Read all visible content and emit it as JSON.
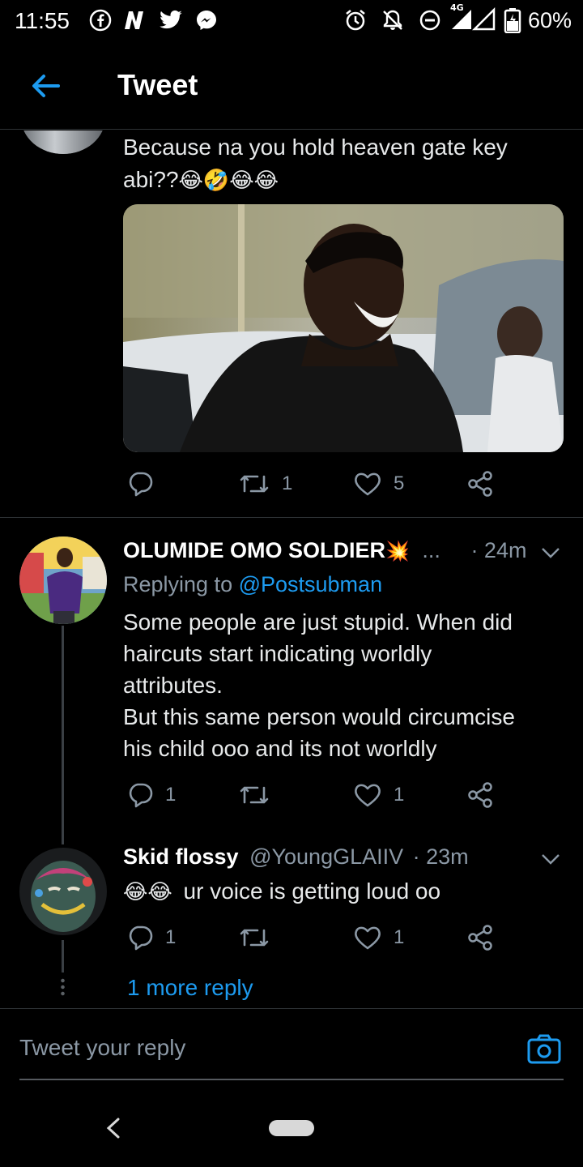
{
  "status_bar": {
    "time": "11:55",
    "battery": "60%",
    "network": "4G",
    "left_icons": [
      "facebook-icon",
      "n-app-icon",
      "twitter-icon",
      "messenger-icon"
    ],
    "right_icons": [
      "alarm-icon",
      "mute-icon",
      "do-not-disturb-icon",
      "signal-icon",
      "battery-icon"
    ]
  },
  "header": {
    "title": "Tweet",
    "back_icon": "arrow-left-icon"
  },
  "tweet_1": {
    "text_line1": "Because na you hold heaven gate key",
    "text_line2": "abi??",
    "emojis": "😂🤣😂😂",
    "image_alt": "laughing man photo",
    "reply_count": "",
    "retweet_count": "1",
    "like_count": "5"
  },
  "tweet_2": {
    "name": "OLUMIDE OMO SOLDIER",
    "name_emoji": "💥",
    "ellipsis": "...",
    "time": "· 24m",
    "replying_prefix": "Replying to ",
    "replying_handle": "@Postsubman",
    "line1": "Some people are just stupid. When did",
    "line2": "haircuts start indicating worldly",
    "line3": "attributes.",
    "line4": "But this same person would circumcise",
    "line5": "his child ooo and its not worldly",
    "reply_count": "1",
    "retweet_count": "",
    "like_count": "1"
  },
  "tweet_3": {
    "name": "Skid flossy",
    "handle": "@YoungGLAIIV",
    "time": "· 23m",
    "emojis": "😂😂",
    "text": "ur voice is getting loud oo",
    "reply_count": "1",
    "retweet_count": "",
    "like_count": "1"
  },
  "more_replies": "1 more reply",
  "reply_bar": {
    "placeholder": "Tweet your reply",
    "camera_icon": "camera-icon"
  },
  "colors": {
    "accent": "#1d9bf0",
    "muted": "#8b98a5",
    "background": "#000000"
  }
}
